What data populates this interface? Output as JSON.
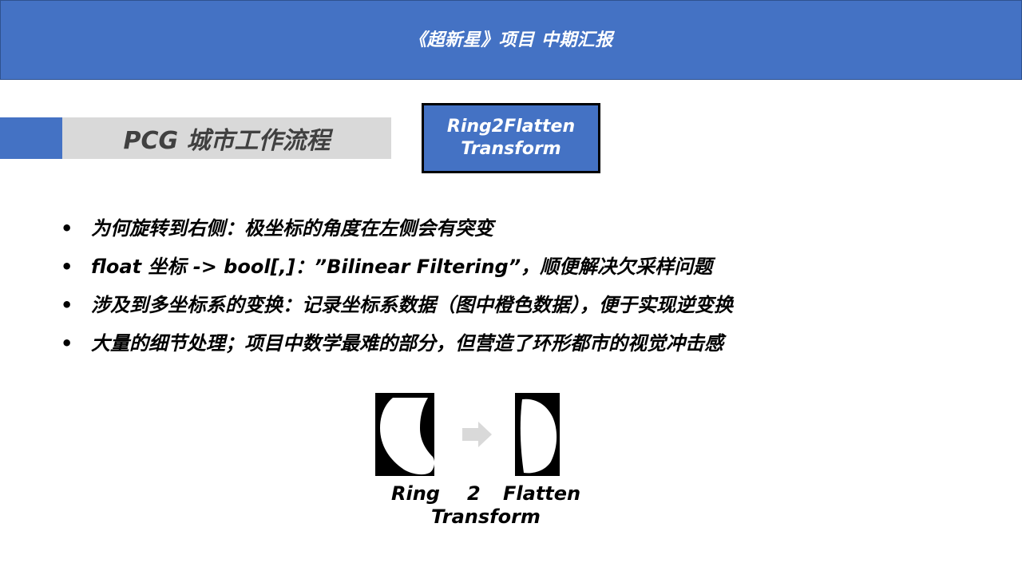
{
  "header": {
    "title": "《超新星》项目 中期汇报"
  },
  "section": {
    "title": "PCG 城市工作流程"
  },
  "badge": {
    "line1": "Ring2Flatten",
    "line2": "Transform"
  },
  "bullets": [
    "为何旋转到右侧：极坐标的角度在左侧会有突变",
    "float 坐标 -> bool[,]：”Bilinear Filtering”，顺便解决欠采样问题",
    "涉及到多坐标系的变换：记录坐标系数据（图中橙色数据），便于实现逆变换",
    "大量的细节处理；项目中数学最难的部分，但营造了环形都市的视觉冲击感"
  ],
  "figure": {
    "label_ring": "Ring",
    "label_two": "2",
    "label_flatten": "Flatten",
    "label_transform": "Transform",
    "arrow_icon": "right-arrow-icon"
  },
  "colors": {
    "accent": "#4472c4",
    "section_bg": "#d9d9d9",
    "section_text": "#404040",
    "arrow": "#d9d9d9"
  }
}
